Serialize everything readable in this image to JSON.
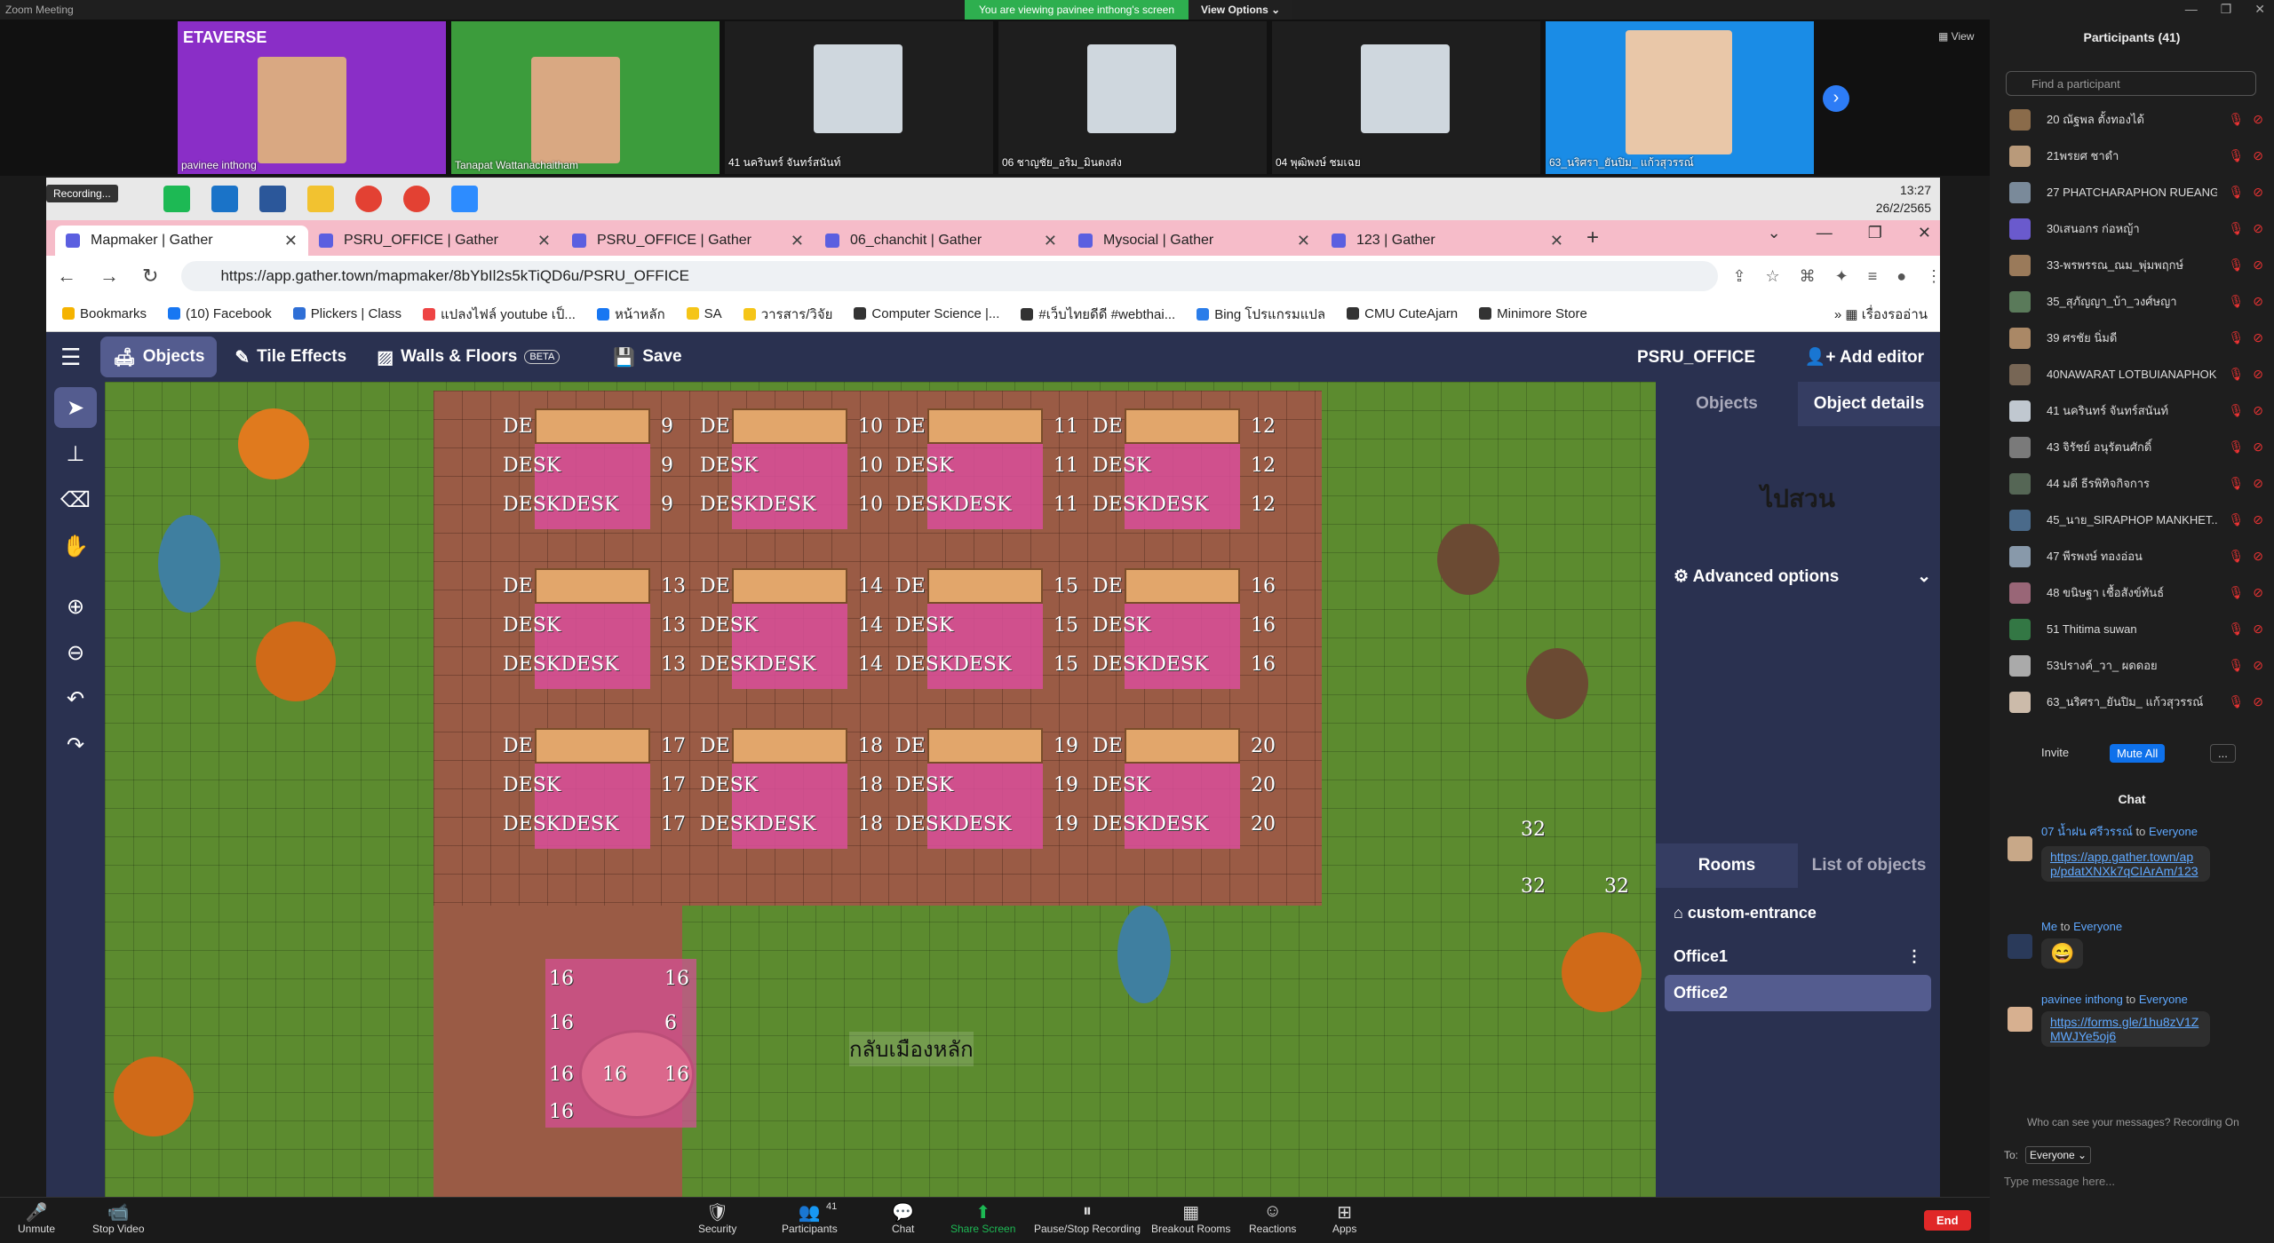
{
  "app": {
    "title": "Zoom Meeting"
  },
  "banner": {
    "message": "You are viewing pavinee inthong's screen",
    "options": "View Options ⌄"
  },
  "video_strip": {
    "view_label": "View",
    "tiles": [
      {
        "name": "pavinee inthong",
        "poster": "ETAVERSE",
        "color": "#8a2ec7"
      },
      {
        "name": "Tanapat Wattanachaitham",
        "color": "#3c9c3c"
      },
      {
        "name": "41 นครินทร์ จันทร์สนันท์",
        "color": "#222"
      },
      {
        "name": "06 ชาญชัย_อริม_มินตงส่ง",
        "color": "#222"
      },
      {
        "name": "04 พุฒิพงษ์ ชมเฉย",
        "color": "#222"
      },
      {
        "name": "63_นริศรา_ยันปิม_ แก้วสุวรรณ์",
        "color": "#1a8ce6"
      }
    ]
  },
  "os": {
    "recording": "Recording...",
    "time": "13:27",
    "date": "26/2/2565"
  },
  "browser": {
    "tabs": [
      {
        "label": "Mapmaker | Gather",
        "active": true
      },
      {
        "label": "PSRU_OFFICE | Gather"
      },
      {
        "label": "PSRU_OFFICE | Gather"
      },
      {
        "label": "06_chanchit | Gather"
      },
      {
        "label": "Mysocial | Gather"
      },
      {
        "label": "123 | Gather"
      }
    ],
    "new_tab": "+",
    "url": "https://app.gather.town/mapmaker/8bYbIl2s5kTiQD6u/PSRU_OFFICE",
    "bookmarks": [
      "Bookmarks",
      "(10) Facebook",
      "Plickers | Class",
      "แปลงไฟล์ youtube เป็...",
      "หน้าหลัก",
      "SA",
      "วารสาร/วิจัย",
      "Computer Science |...",
      "#เว็บไทยดีดี #webthai...",
      "Bing โปรแกรมแปล",
      "CMU CuteAjarn",
      "Minimore Store"
    ],
    "bookmarks_other": "เรื่องรออ่าน"
  },
  "gather": {
    "menu": [
      {
        "label": "Objects",
        "icon": "🛋"
      },
      {
        "label": "Tile Effects",
        "icon": "✎"
      },
      {
        "label": "Walls & Floors",
        "icon": "▨",
        "badge": "BETA"
      },
      {
        "label": "Save",
        "icon": "💾"
      }
    ],
    "space_name": "PSRU_OFFICE",
    "add_editor": "Add editor",
    "tools": [
      "select-tool",
      "stamp-tool",
      "eraser-tool",
      "hand-tool",
      "zoom-in-tool",
      "zoom-out-tool",
      "undo-tool",
      "redo-tool"
    ],
    "side_tabs": [
      "Objects",
      "Object details"
    ],
    "object_name": "ไปสวน",
    "advanced": "Advanced options",
    "rooms_tabs": [
      "Rooms",
      "List of objects"
    ],
    "rooms": [
      {
        "name": "custom-entrance"
      },
      {
        "name": "Office1"
      },
      {
        "name": "Office2"
      }
    ],
    "map": {
      "desk_rows": [
        {
          "nums": [
            "9",
            "10",
            "11",
            "12"
          ]
        },
        {
          "nums": [
            "13",
            "14",
            "15",
            "16"
          ]
        },
        {
          "nums": [
            "17",
            "18",
            "19",
            "20"
          ]
        }
      ],
      "prefix_a": "DE",
      "prefix_b": "DESK",
      "prefix_c": "DESKDESK",
      "round_table": [
        "16",
        "16",
        "16",
        "6",
        "16",
        "16",
        "16",
        "16"
      ],
      "corner": [
        "32",
        "32",
        "32"
      ],
      "return_label": "กลับเมืองหลัก"
    }
  },
  "zoom_side": {
    "participants_title": "Participants (41)",
    "find_placeholder": "Find a participant",
    "participants": [
      "20 ณัฐพล ตั้งทองได้",
      "21พรยศ ชาดำ",
      "27 PHATCHARAPHON RUEANG...",
      "30เสนอกร ก่อหญ้า",
      "33-พรพรรณ_ณม_พุ่มพฤกษ์",
      "35_สุภัญญา_บ้า_วงศ์ษญา",
      "39 ศรชัย นิ่มดี",
      "40NAWARAT LOTBUIANAPHOK...",
      "41 นครินทร์ จันทร์สนันท์",
      "43 จิรัชย์ อนุรัตนศักดิ์",
      "44 มดี ธีรพิทิจกิจการ",
      "45_นาย_SIRAPHOP MANKHET...",
      "47 พีรพงษ์ ทองอ่อน",
      "48 ขนิษฐา เชื้อสังข์ทันธ์",
      "51 Thitima suwan",
      "53ปรางค์_วา_ ผดดอย",
      "63_นริศรา_ยันปิม_ แก้วสุวรรณ์"
    ],
    "invite": "Invite",
    "mute_all": "Mute All",
    "more": "...",
    "chat_title": "Chat",
    "messages": [
      {
        "from": "07 น้ำฝน ศรีวรรณ์",
        "to": "Everyone",
        "text": "https://app.gather.town/app/pdatXNXk7qCIArAm/123"
      },
      {
        "from": "Me",
        "to": "Everyone",
        "text": "😄"
      },
      {
        "from": "pavinee inthong",
        "to": "Everyone",
        "text": "https://forms.gle/1hu8zV1ZMWJYe5oj6"
      }
    ],
    "who_can_see": "Who can see your messages? Recording On",
    "to_label": "To:",
    "to_value": "Everyone ⌄",
    "type_placeholder": "Type message here..."
  },
  "zoom_bar": {
    "items": [
      {
        "label": "Unmute",
        "icon": "🎤"
      },
      {
        "label": "Stop Video",
        "icon": "📹"
      },
      {
        "label": "Security",
        "icon": "🛡"
      },
      {
        "label": "Participants",
        "icon": "👥",
        "count": "41"
      },
      {
        "label": "Chat",
        "icon": "💬"
      },
      {
        "label": "Share Screen",
        "icon": "⬆"
      },
      {
        "label": "Pause/Stop Recording",
        "icon": "⏸"
      },
      {
        "label": "Breakout Rooms",
        "icon": "▦"
      },
      {
        "label": "Reactions",
        "icon": "☺"
      },
      {
        "label": "Apps",
        "icon": "⊞"
      }
    ],
    "end": "End"
  }
}
